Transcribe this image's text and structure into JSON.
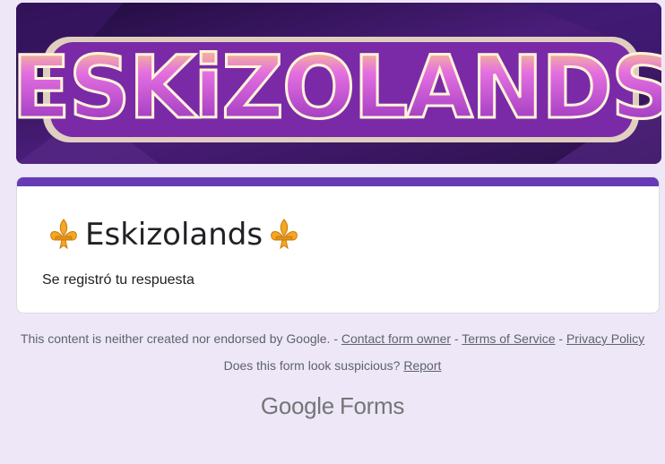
{
  "banner": {
    "text": "ESKiZOLANDS",
    "colors": {
      "background": "#2a1245",
      "letter_fill": "#c24fd8",
      "letter_highlight": "#ffd84a",
      "letter_outline": "#f4ead0"
    }
  },
  "form": {
    "title": "Eskizolands",
    "title_icon": "fleur-de-lis-icon",
    "confirmation": "Se registró tu respuesta",
    "accent_color": "#673ab7"
  },
  "footer": {
    "disclaimer": "This content is neither created nor endorsed by Google. -",
    "contact_link": "Contact form owner",
    "separator": "-",
    "terms_link": "Terms of Service",
    "privacy_link": "Privacy Policy",
    "suspicious_text": "Does this form look suspicious?",
    "report_link": "Report"
  },
  "brand": {
    "google": "Google",
    "forms": "Forms"
  }
}
